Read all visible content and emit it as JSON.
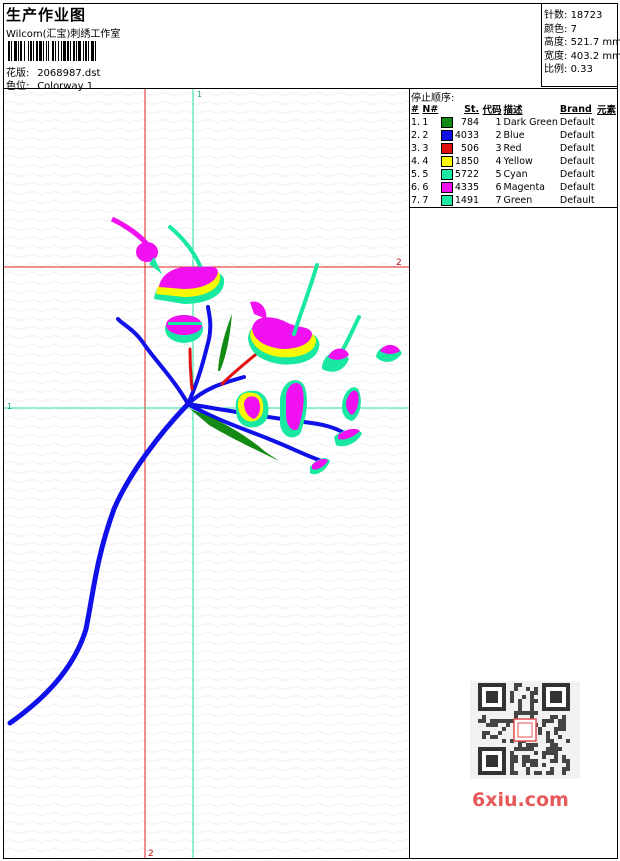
{
  "header": {
    "title": "生产作业图",
    "company": "Wilcom(汇宝)刺绣工作室",
    "design_label": "花版:",
    "design_file": "2068987.dst",
    "colorway_label": "色位:",
    "colorway": "Colorway 1"
  },
  "stats": [
    {
      "label": "针数:",
      "value": "18723"
    },
    {
      "label": "颜色:",
      "value": "7"
    },
    {
      "label": "高度:",
      "value": "521.7 mm"
    },
    {
      "label": "宽度:",
      "value": "403.2 mm"
    },
    {
      "label": "比例:",
      "value": "0.33"
    }
  ],
  "stop_sequence": {
    "heading": "停止顺序:",
    "columns": [
      "#",
      "N#",
      "St.",
      "代码",
      "描述",
      "Brand",
      "元素"
    ],
    "rows": [
      {
        "idx": "1.",
        "n": "1",
        "color": "#138a13",
        "st": "784",
        "code": "1",
        "desc": "Dark Green",
        "brand": "Default"
      },
      {
        "idx": "2.",
        "n": "2",
        "color": "#1010e8",
        "st": "4033",
        "code": "2",
        "desc": "Blue",
        "brand": "Default"
      },
      {
        "idx": "3.",
        "n": "3",
        "color": "#e01010",
        "st": "506",
        "code": "3",
        "desc": "Red",
        "brand": "Default"
      },
      {
        "idx": "4.",
        "n": "4",
        "color": "#f8f800",
        "st": "1850",
        "code": "4",
        "desc": "Yellow",
        "brand": "Default"
      },
      {
        "idx": "5.",
        "n": "5",
        "color": "#18e8a0",
        "st": "5722",
        "code": "5",
        "desc": "Cyan",
        "brand": "Default"
      },
      {
        "idx": "6.",
        "n": "6",
        "color": "#f010f0",
        "st": "4335",
        "code": "6",
        "desc": "Magenta",
        "brand": "Default"
      },
      {
        "idx": "7.",
        "n": "7",
        "color": "#18e8a0",
        "st": "1491",
        "code": "7",
        "desc": "Green",
        "brand": "Default"
      }
    ]
  },
  "guides": {
    "v1": "1",
    "h2": "2",
    "h1": "1",
    "v2": "2"
  },
  "watermark": "6xiu.com",
  "colors": {
    "guide_red": "#e02020",
    "guide_green": "#20e0a0"
  }
}
